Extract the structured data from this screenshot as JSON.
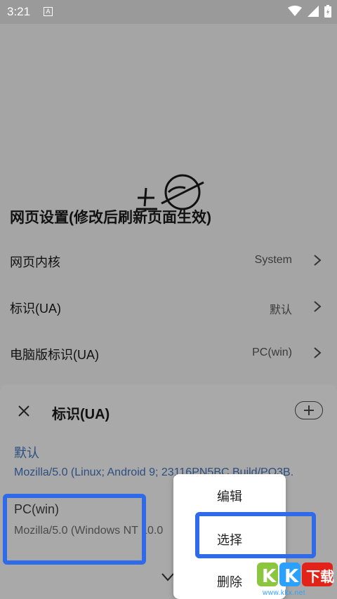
{
  "status_bar": {
    "time": "3:21",
    "icons": [
      "a-badge-icon",
      "wifi-icon",
      "signal-icon",
      "battery-charging-icon"
    ]
  },
  "settings": {
    "section_title": "网页设置(修改后刷新页面生效)",
    "rows": [
      {
        "label": "网页内核",
        "value": "System"
      },
      {
        "label": "标识(UA)",
        "value": "默认"
      },
      {
        "label": "电脑版标识(UA)",
        "value": "PC(win)"
      }
    ]
  },
  "sheet": {
    "title": "标识(UA)",
    "items": [
      {
        "title": "默认",
        "value": "Mozilla/5.0 (Linux; Android 9; 23116PN5BC Build/PQ3B."
      },
      {
        "title": "PC(win)",
        "value": "Mozilla/5.0 (Windows NT 10.0"
      }
    ]
  },
  "popup_menu": {
    "items": [
      "编辑",
      "选择",
      "删除"
    ]
  },
  "watermark": {
    "brand": "KK下载",
    "url": "www.kkx.net"
  },
  "colors": {
    "highlight": "#2f6be9",
    "link_blue": "#2b4f80"
  }
}
